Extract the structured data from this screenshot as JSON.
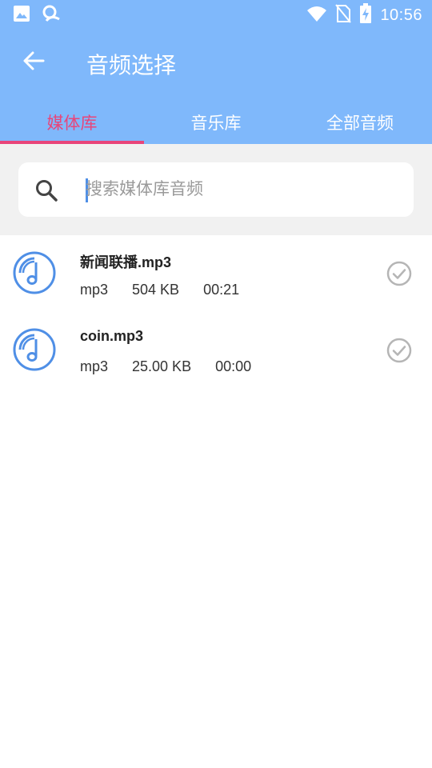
{
  "status_bar": {
    "time": "10:56",
    "left_icons": [
      "image-icon",
      "app-notification-icon"
    ],
    "right_icons": [
      "wifi-icon",
      "no-sim-icon",
      "battery-charging-icon"
    ]
  },
  "toolbar": {
    "title": "音频选择",
    "back_icon": "arrow-left-icon"
  },
  "tabs": [
    {
      "label": "媒体库",
      "active": true
    },
    {
      "label": "音乐库",
      "active": false
    },
    {
      "label": "全部音频",
      "active": false
    }
  ],
  "search": {
    "placeholder": "搜索媒体库音频",
    "value": ""
  },
  "files": [
    {
      "name": "新闻联播.mp3",
      "format": "mp3",
      "size": "504 KB",
      "duration": "00:21"
    },
    {
      "name": "coin.mp3",
      "format": "mp3",
      "size": "25.00 KB",
      "duration": "00:00"
    }
  ],
  "colors": {
    "header_bg": "#7fb8fb",
    "tab_active": "#e8457a",
    "icon_blue": "#4f8fe6",
    "check_gray": "#b5b5b5"
  }
}
